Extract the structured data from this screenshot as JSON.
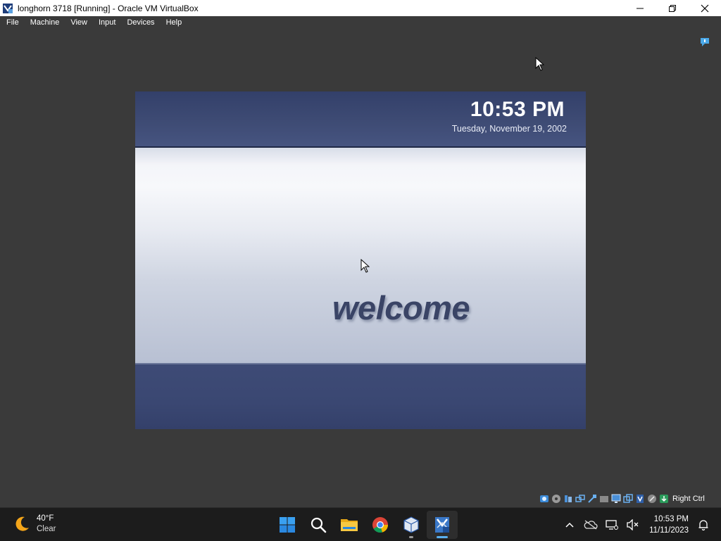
{
  "window": {
    "title": "longhorn 3718 [Running] - Oracle VM VirtualBox",
    "controls": [
      "minimize-icon",
      "maximize-icon",
      "close-icon"
    ]
  },
  "menu": {
    "items": [
      {
        "label": "File"
      },
      {
        "label": "Machine"
      },
      {
        "label": "View"
      },
      {
        "label": "Input"
      },
      {
        "label": "Devices"
      },
      {
        "label": "Help"
      }
    ]
  },
  "guest": {
    "time": "10:53 PM",
    "date": "Tuesday, November 19, 2002",
    "welcome": "welcome",
    "colors": {
      "band": "#3e4b74",
      "text": "#3a4466"
    }
  },
  "vbox_status": {
    "icons": [
      "hard-disk-icon",
      "optical-drive-icon",
      "audio-icon",
      "network-icon",
      "usb-icon",
      "shared-folders-icon",
      "display-icon",
      "recording-icon",
      "virtualization-icon",
      "mouse-integration-icon",
      "keyboard-icon"
    ],
    "host_key": "Right Ctrl"
  },
  "taskbar": {
    "weather": {
      "temp": "40°F",
      "condition": "Clear",
      "icon": "moon-icon"
    },
    "apps": [
      "start-icon",
      "search-icon",
      "file-explorer-icon",
      "chrome-icon",
      "virtualbox-icon",
      "virtualbox-vm-icon"
    ],
    "clock_time": "10:53 PM",
    "clock_date": "11/11/2023",
    "tray_icons": [
      "chevron-up-icon",
      "onedrive-icon",
      "network-icon",
      "volume-muted-icon",
      "notification-bell-icon"
    ]
  }
}
